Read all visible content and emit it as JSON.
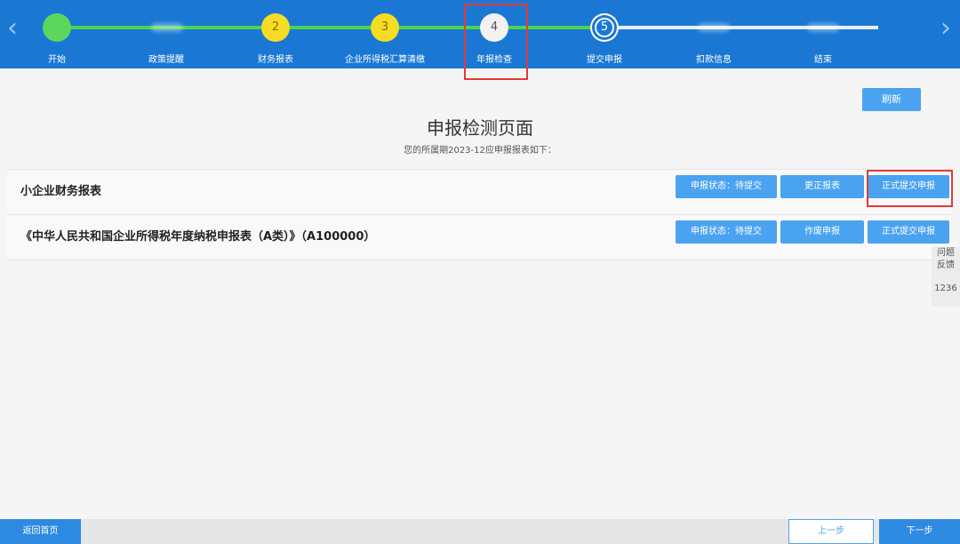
{
  "stepper": {
    "prev_arrow": "‹",
    "next_arrow": "›",
    "steps": [
      {
        "label": "开始",
        "number": "",
        "state": "done"
      },
      {
        "label": "政策提醒",
        "number": "",
        "state": "blurred"
      },
      {
        "label": "财务报表",
        "number": "2",
        "state": "pending-yellow"
      },
      {
        "label": "企业所得税汇算清缴",
        "number": "3",
        "state": "pending-yellow"
      },
      {
        "label": "年报检查",
        "number": "4",
        "state": "current"
      },
      {
        "label": "提交申报",
        "number": "5",
        "state": "next"
      },
      {
        "label": "扣款信息",
        "number": "",
        "state": "blurred"
      },
      {
        "label": "结束",
        "number": "",
        "state": "blurred"
      }
    ]
  },
  "toolbar": {
    "refresh_label": "刷新"
  },
  "page": {
    "title": "申报检测页面",
    "subtitle": "您的所属期2023-12应申报报表如下："
  },
  "rows": [
    {
      "name": "小企业财务报表",
      "status_label": "申报状态：待提交",
      "action_label": "更正报表",
      "submit_label": "正式提交申报"
    },
    {
      "name": "《中华人民共和国企业所得税年度纳税申报表（A类）》（A100000）",
      "status_label": "申报状态：待提交",
      "action_label": "作废申报",
      "submit_label": "正式提交申报"
    }
  ],
  "feedback": {
    "line1": "问题",
    "line2": "反馈",
    "number": "1236"
  },
  "footer": {
    "home_label": "返回首页",
    "prev_label": "上一步",
    "next_label": "下一步"
  },
  "colors": {
    "header_blue": "#1a78d4",
    "button_blue": "#4aa3f0",
    "progress_green": "#4cd54c",
    "step_yellow": "#f6dc23",
    "highlight_red": "#e53935"
  }
}
